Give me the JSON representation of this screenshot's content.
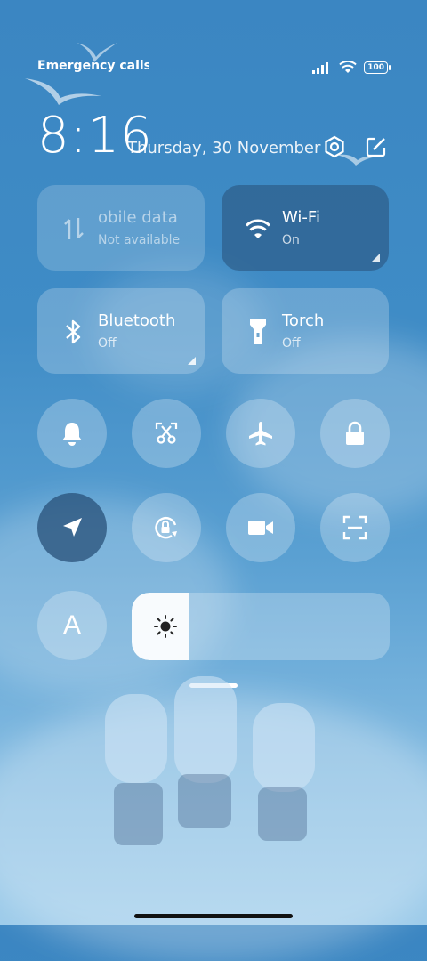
{
  "status_bar": {
    "carrier_text": "Emergency calls o",
    "battery": "100"
  },
  "header": {
    "time": "8:16",
    "date": "Thursday, 30 November",
    "settings_icon": "settings-icon",
    "edit_icon": "edit-icon"
  },
  "tiles": [
    {
      "title": "obile data",
      "subtitle": "Not available",
      "icon": "mobile-data-icon",
      "state": "unavailable"
    },
    {
      "title": "Wi-Fi",
      "subtitle": "On",
      "icon": "wifi-icon",
      "state": "on"
    },
    {
      "title": "Bluetooth",
      "subtitle": "Off",
      "icon": "bluetooth-icon",
      "state": "off"
    },
    {
      "title": "Torch",
      "subtitle": "Off",
      "icon": "torch-icon",
      "state": "off"
    }
  ],
  "toggles_row1": [
    {
      "icon": "bell-icon",
      "state": "off"
    },
    {
      "icon": "screenshot-icon",
      "state": "off"
    },
    {
      "icon": "airplane-icon",
      "state": "off"
    },
    {
      "icon": "lock-icon",
      "state": "off"
    }
  ],
  "toggles_row2": [
    {
      "icon": "location-icon",
      "state": "on"
    },
    {
      "icon": "rotation-lock-icon",
      "state": "off"
    },
    {
      "icon": "video-camera-icon",
      "state": "off"
    },
    {
      "icon": "scan-icon",
      "state": "off"
    }
  ],
  "auto_brightness": {
    "label": "A",
    "icon": "font-size-icon"
  },
  "brightness": {
    "level_percent": 22,
    "icon": "sun-icon"
  },
  "colors": {
    "active_tile": "#2f5f88",
    "accent": "#ffffff"
  }
}
